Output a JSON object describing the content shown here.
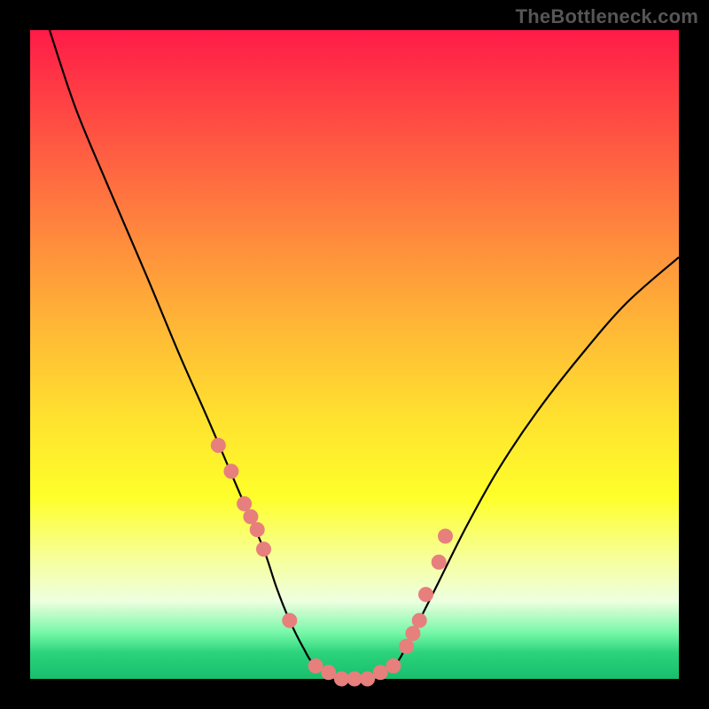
{
  "watermark": "TheBottleneck.com",
  "colors": {
    "dot": "#e77f7d",
    "curve": "#000000",
    "frame_bg_top": "#ff1b48",
    "frame_bg_bottom": "#19be6d",
    "page_bg": "#000000"
  },
  "chart_data": {
    "type": "line",
    "title": "",
    "xlabel": "",
    "ylabel": "",
    "xlim": [
      0,
      100
    ],
    "ylim": [
      0,
      100
    ],
    "grid": false,
    "legend": false,
    "annotations": [],
    "series": [
      {
        "name": "bottleneck-curve",
        "x": [
          3,
          7,
          12,
          18,
          23,
          27,
          30,
          33,
          36,
          38,
          40,
          42,
          44,
          48,
          52,
          56,
          58,
          60,
          63,
          67,
          72,
          78,
          85,
          92,
          100
        ],
        "y": [
          100,
          88,
          76,
          62,
          50,
          41,
          34,
          27,
          20,
          14,
          9,
          5,
          2,
          0,
          0,
          2,
          5,
          9,
          15,
          23,
          32,
          41,
          50,
          58,
          65
        ]
      }
    ],
    "scatter_points": {
      "name": "highlight-dots",
      "x": [
        29,
        31,
        33,
        34,
        35,
        36,
        40,
        44,
        46,
        48,
        50,
        52,
        54,
        56,
        58,
        59,
        60,
        61,
        63,
        64
      ],
      "y": [
        36,
        32,
        27,
        25,
        23,
        20,
        9,
        2,
        1,
        0,
        0,
        0,
        1,
        2,
        5,
        7,
        9,
        13,
        18,
        22
      ]
    }
  }
}
